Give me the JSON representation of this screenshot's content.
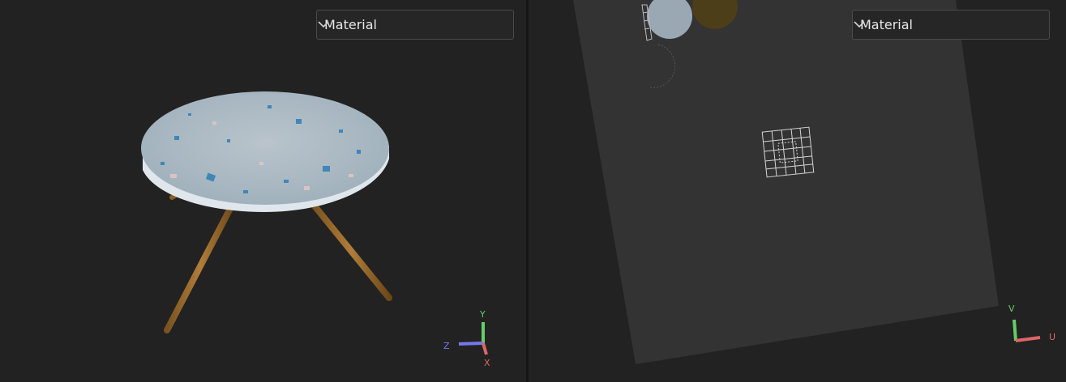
{
  "viewports": {
    "model": {
      "mode_select": {
        "value": "Material",
        "icon": "chevron-down-icon"
      },
      "axis_gizmo": {
        "y_label": "Y",
        "z_label": "Z",
        "x_label": "X",
        "colors": {
          "y": "#66cc66",
          "z": "#7777ee",
          "x": "#dd6666"
        }
      }
    },
    "uv": {
      "mode_select": {
        "value": "Material",
        "icon": "chevron-down-icon"
      },
      "axis_gizmo": {
        "v_label": "V",
        "u_label": "U",
        "colors": {
          "v": "#66cc66",
          "u": "#dd6666"
        }
      }
    }
  }
}
